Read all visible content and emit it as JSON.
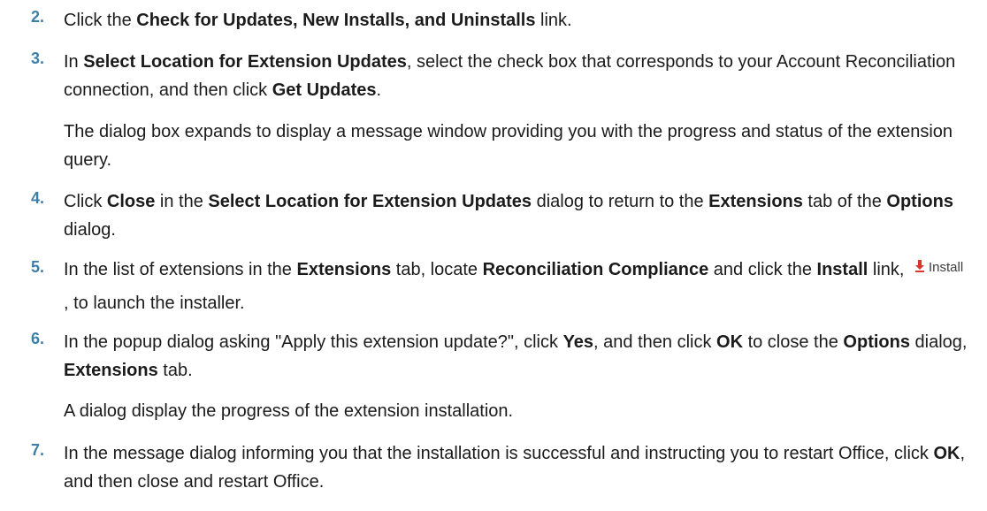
{
  "steps": [
    {
      "number": "2.",
      "t1": "Click the ",
      "b1": "Check for Updates, New Installs, and Uninstalls",
      "t2": " link."
    },
    {
      "number": "3.",
      "t1": "In ",
      "b1": "Select Location for Extension Updates",
      "t2": ", select the check box that corresponds to your Account Reconciliation connection, and then click ",
      "b2": "Get Updates",
      "t3": ".",
      "note": "The dialog box expands to display a message window providing you with the progress and status of the extension query."
    },
    {
      "number": "4.",
      "t1": "Click ",
      "b1": "Close",
      "t2": " in the ",
      "b2": "Select Location for Extension Updates",
      "t3": " dialog to return to the ",
      "b3": "Extensions",
      "t4": " tab of the ",
      "b4": "Options",
      "t5": " dialog."
    },
    {
      "number": "5.",
      "t1": "In the list of extensions in the ",
      "b1": "Extensions",
      "t2": " tab, locate ",
      "b2": "Reconciliation Compliance",
      "t3": " and click the ",
      "b3": "Install",
      "t4": " link, ",
      "icon_label": "Install",
      "icon_name": "install-download-icon",
      "t5": ", to launch the installer."
    },
    {
      "number": "6.",
      "t1": "In the popup dialog asking \"Apply this extension update?\", click ",
      "b1": "Yes",
      "t2": ", and then click ",
      "b2": "OK",
      "t3": " to close the ",
      "b3": "Options",
      "t4": " dialog, ",
      "b4": "Extensions",
      "t5": " tab.",
      "note": "A dialog display the progress of the extension installation."
    },
    {
      "number": "7.",
      "t1": "In the message dialog informing you that the installation is successful and instructing you to restart Office, click ",
      "b1": "OK",
      "t2": ", and then close and restart Office."
    }
  ],
  "colors": {
    "step_number": "#3e7fa8",
    "text": "#1b1b1b",
    "install_arrow": "#d9352b"
  }
}
